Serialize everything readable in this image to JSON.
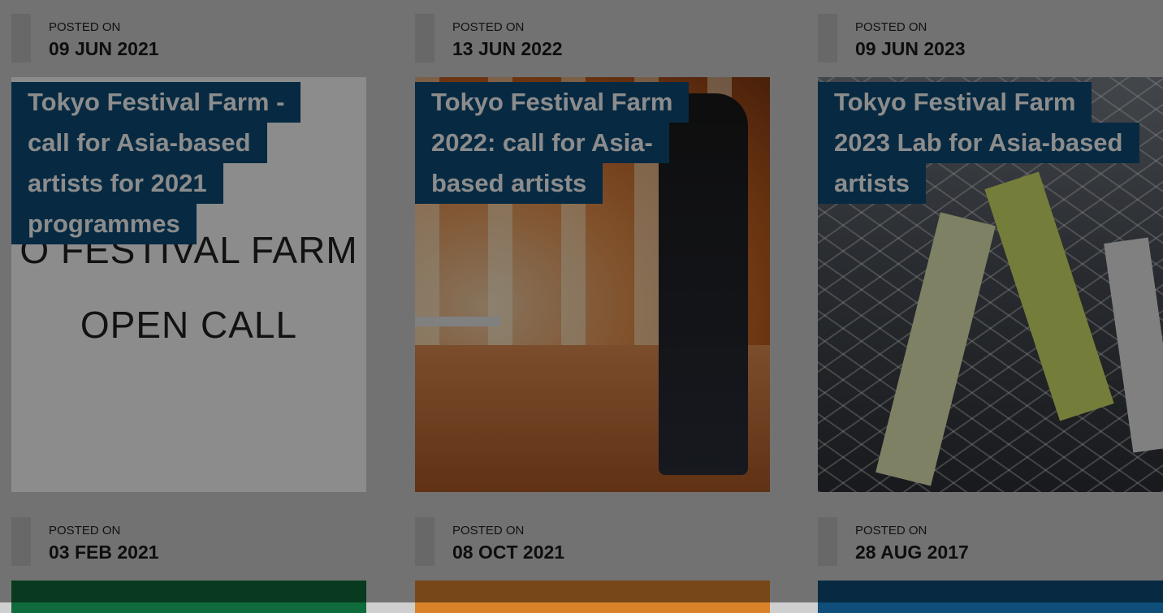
{
  "posted_label": "POSTED ON",
  "colors": {
    "title_bg": "#0e4e78",
    "title_text": "#ffffff",
    "overlay": "rgba(0,0,0,0.45)"
  },
  "cards": [
    {
      "date": "09 JUN 2021",
      "title_lines": [
        "Tokyo Festival Farm -",
        "call for Asia-based",
        "artists for 2021",
        "programmes"
      ],
      "thumb_text": [
        "O FESTIVAL FARM",
        "OPEN CALL"
      ]
    },
    {
      "date": "13 JUN 2022",
      "title_lines": [
        "Tokyo Festival Farm",
        "2022: call for Asia-",
        "based artists"
      ]
    },
    {
      "date": "09 JUN 2023",
      "title_lines": [
        "Tokyo Festival Farm",
        "2023 Lab for Asia-based",
        "artists"
      ]
    },
    {
      "date": "03 FEB 2021"
    },
    {
      "date": "08 OCT 2021"
    },
    {
      "date": "28 AUG 2017"
    }
  ]
}
